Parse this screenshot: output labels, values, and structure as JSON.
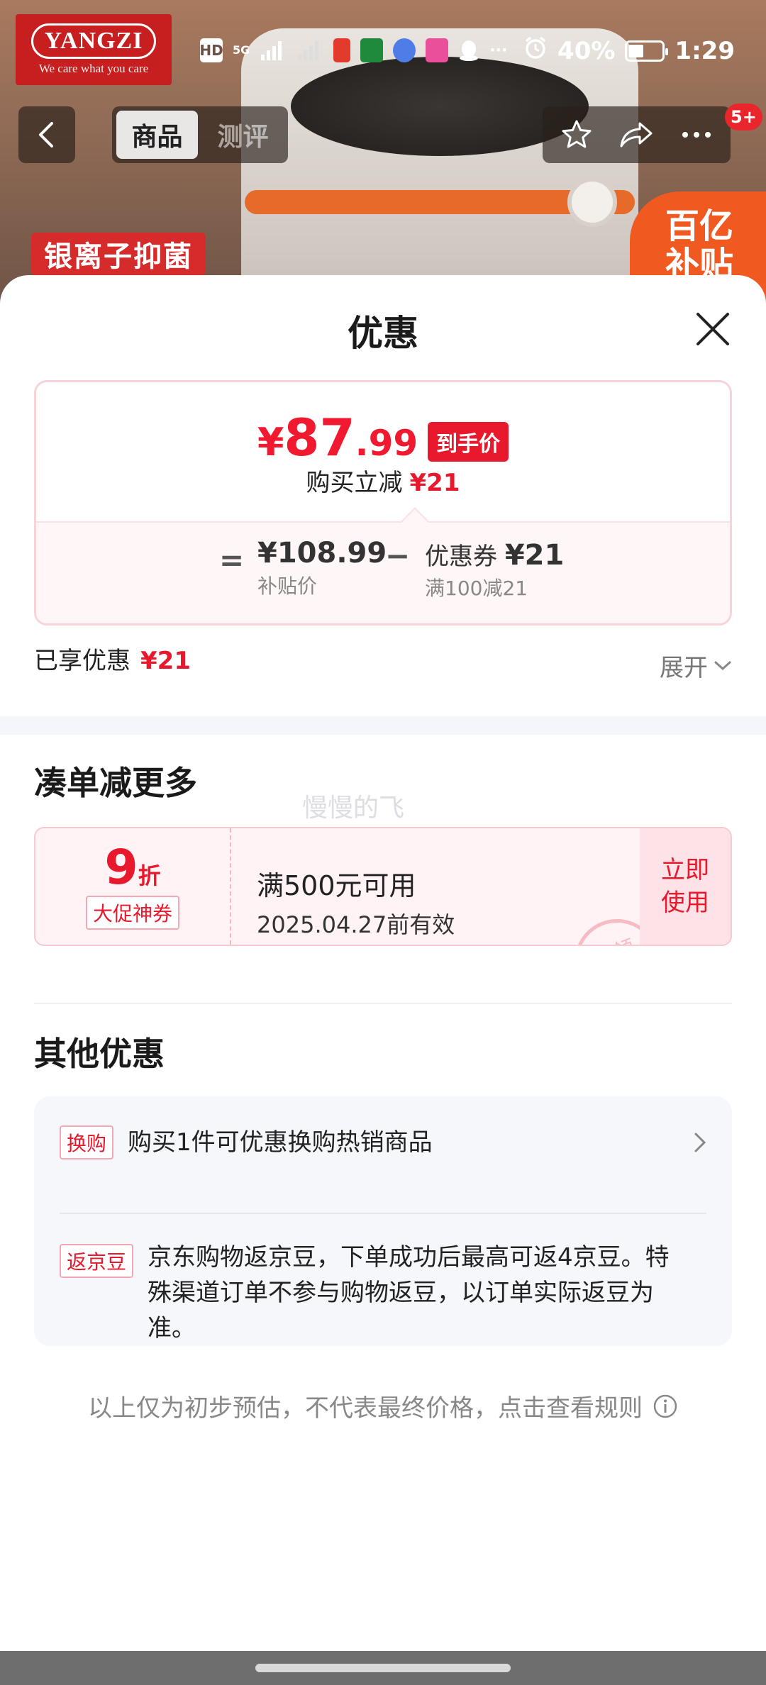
{
  "hero": {
    "brand_name": "YANGZI",
    "brand_slogan": "We care what you care",
    "feature_tag": "银离子抑菌",
    "subsidy_tag": "百亿补贴"
  },
  "status_bar": {
    "hd_label": "HD",
    "network_label": "5G",
    "battery_percent": "40%",
    "time": "1:29",
    "more_dots": "···"
  },
  "nav": {
    "tabs": [
      {
        "label": "商品",
        "active": true
      },
      {
        "label": "测评",
        "active": false
      }
    ],
    "message_badge": "5+"
  },
  "sheet": {
    "title": "优惠",
    "final_price": {
      "currency": "¥",
      "integer": "87",
      "decimal": ".99",
      "tag": "到手价"
    },
    "reduce": {
      "label": "购买立减",
      "amount": "¥21"
    },
    "calc": {
      "equals": "=",
      "base_value": "¥108.99",
      "base_label": "补贴价",
      "minus": "−",
      "coupon_label": "优惠券",
      "coupon_value": "¥21",
      "coupon_rule": "满100减21"
    },
    "enjoyed": {
      "label": "已享优惠",
      "amount": "¥21"
    },
    "expand_label": "展开"
  },
  "bundle": {
    "title": "凑单减更多",
    "watermark": "慢慢的飞",
    "coupon": {
      "discount_number": "9",
      "discount_unit": "折",
      "type": "大促神券",
      "condition": "满500元可用",
      "valid_until": "2025.04.27前有效",
      "action": "立即使用",
      "stamp": "已领"
    }
  },
  "other": {
    "title": "其他优惠",
    "items": [
      {
        "tag": "换购",
        "text": "购买1件可优惠换购热销商品"
      },
      {
        "tag": "返京豆",
        "text": "京东购物返京豆，下单成功后最高可返4京豆。特殊渠道订单不参与购物返豆，以订单实际返豆为准。"
      }
    ]
  },
  "footer_note": "以上仅为初步预估，不代表最终价格，点击查看规则",
  "colors": {
    "accent_red": "#e8192c",
    "coupon_bg": "#fff3f5",
    "panel_bg": "#f6f7fb"
  }
}
